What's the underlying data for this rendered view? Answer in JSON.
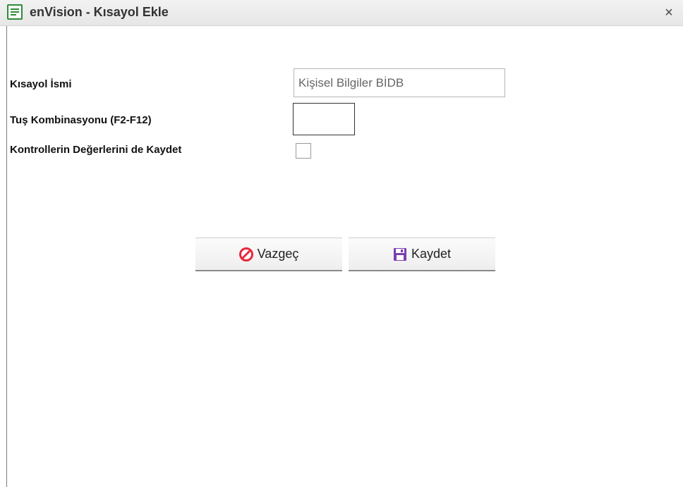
{
  "window": {
    "title": "enVision - Kısayol Ekle",
    "close_glyph": "×",
    "icon": "document-list-icon"
  },
  "form": {
    "shortcut_name_label": "Kısayol İsmi",
    "shortcut_name_value": "Kişisel Bilgiler BİDB",
    "key_combo_label": "Tuş Kombinasyonu (F2-F12)",
    "key_combo_value": "",
    "save_values_label": "Kontrollerin Değerlerini de Kaydet",
    "save_values_checked": false
  },
  "buttons": {
    "cancel_label": "Vazgeç",
    "cancel_icon": "cancel-icon",
    "save_label": "Kaydet",
    "save_icon": "floppy-disk-icon"
  },
  "colors": {
    "cancel_icon": "#e8283c",
    "save_icon": "#7a3fb0",
    "title_icon": "#2e8b3a"
  }
}
